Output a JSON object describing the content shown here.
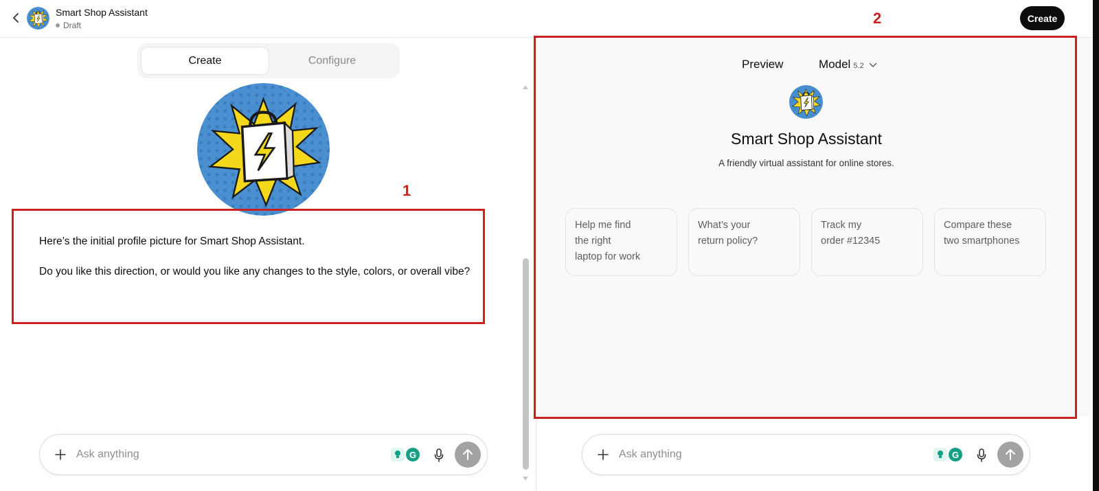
{
  "header": {
    "title": "Smart Shop Assistant",
    "status": "Draft",
    "create_button": "Create"
  },
  "editor": {
    "tabs": [
      {
        "label": "Create",
        "active": true
      },
      {
        "label": "Configure",
        "active": false
      }
    ],
    "message": {
      "line1": "Here’s the initial profile picture for Smart Shop Assistant.",
      "line2": "Do you like this direction, or would you like any changes to the style, colors, or overall vibe?"
    },
    "composer": {
      "placeholder": "Ask anything"
    }
  },
  "preview": {
    "label": "Preview",
    "model_label": "Model",
    "model_version": "5.2",
    "name": "Smart Shop Assistant",
    "description": "A friendly virtual assistant for online stores.",
    "starters": [
      {
        "lines": [
          "Help me find",
          "the right",
          "laptop for work"
        ]
      },
      {
        "lines": [
          "What’s your",
          "return policy?"
        ]
      },
      {
        "lines": [
          "Track my",
          "order #12345"
        ]
      },
      {
        "lines": [
          "Compare these",
          "two smartphones"
        ]
      }
    ],
    "composer": {
      "placeholder": "Ask anything"
    }
  },
  "annotations": {
    "box1_number": "1",
    "box2_number": "2"
  },
  "icons": {
    "back": "chevron-left-icon",
    "avatar": "shopping-bag-lightning-icon",
    "plus": "plus-icon",
    "extension_bulb": "lightbulb-icon",
    "extension_grammarly": "grammarly-icon",
    "mic": "microphone-icon",
    "send": "arrow-up-icon",
    "model_dropdown": "chevron-down-icon"
  },
  "colors": {
    "annotation_red": "#cc1f1f",
    "create_button_bg": "#0d0d0d",
    "send_button_bg": "#a3a3a3",
    "avatar_blue": "#4a90d0",
    "avatar_yellow": "#f4d81c",
    "grammarly_green": "#15a085"
  }
}
